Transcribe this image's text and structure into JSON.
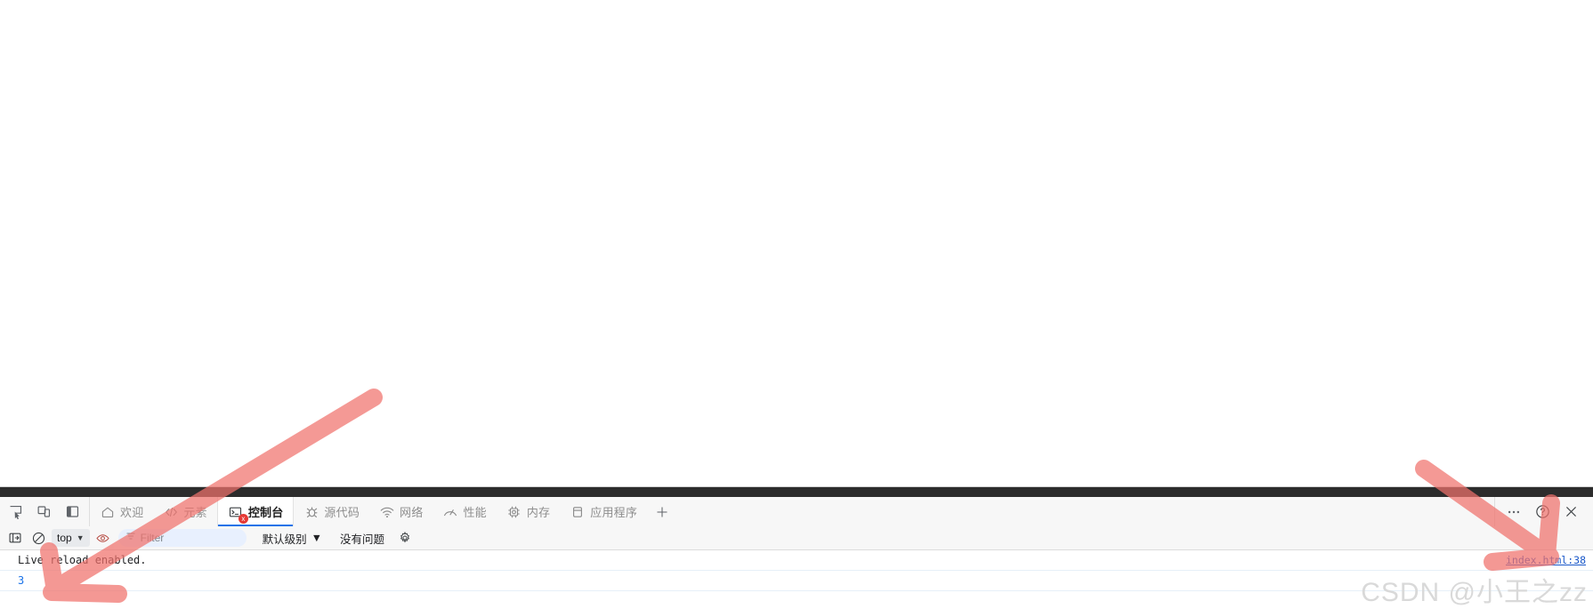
{
  "window": {
    "page_background": "#ffffff",
    "devtools_background": "#f7f7f7",
    "accent": "#1a73e8",
    "annotation_color": "#f28a85"
  },
  "tabbar": {
    "left_icons": [
      {
        "name": "inspect-element-icon",
        "title": "检查"
      },
      {
        "name": "device-toolbar-icon",
        "title": "切换设备工具栏"
      },
      {
        "name": "dock-side-icon",
        "title": "停靠侧边"
      }
    ],
    "tabs": [
      {
        "label": "欢迎",
        "icon": "home-icon",
        "active": false,
        "badge": ""
      },
      {
        "label": "元素",
        "icon": "code-brackets-icon",
        "active": false,
        "badge": ""
      },
      {
        "label": "控制台",
        "icon": "console-terminal-icon",
        "active": true,
        "badge": "x"
      },
      {
        "label": "源代码",
        "icon": "bug-icon",
        "active": false,
        "badge": ""
      },
      {
        "label": "网络",
        "icon": "wifi-icon",
        "active": false,
        "badge": ""
      },
      {
        "label": "性能",
        "icon": "gauge-icon",
        "active": false,
        "badge": ""
      },
      {
        "label": "内存",
        "icon": "chip-icon",
        "active": false,
        "badge": ""
      },
      {
        "label": "应用程序",
        "icon": "database-icon",
        "active": false,
        "badge": ""
      }
    ],
    "add_tab_label": "+",
    "right_buttons": [
      {
        "label": "⋯",
        "name": "more-options-icon"
      },
      {
        "label": "?",
        "name": "help-icon"
      },
      {
        "label": "×",
        "name": "close-devtools-icon"
      }
    ]
  },
  "console_toolbar": {
    "sidebar_toggle": "console-sidebar-icon",
    "clear_console": "clear-console-icon",
    "context_value": "top",
    "context_caret": "▼",
    "live_expression": "eye-icon",
    "filter_placeholder": "Filter",
    "filter_value": "",
    "filter_icon": "filter-funnel-icon",
    "levels_label": "默认级别",
    "levels_caret": "▼",
    "issues_label": "没有问题",
    "settings_icon": "gear-icon"
  },
  "console_log": {
    "rows": [
      {
        "message": "Live reload enabled.",
        "kind": "log",
        "source": "index.html:38"
      },
      {
        "message": "3",
        "kind": "result",
        "source": ""
      }
    ]
  },
  "watermark": {
    "text": "CSDN @小王之zz"
  }
}
